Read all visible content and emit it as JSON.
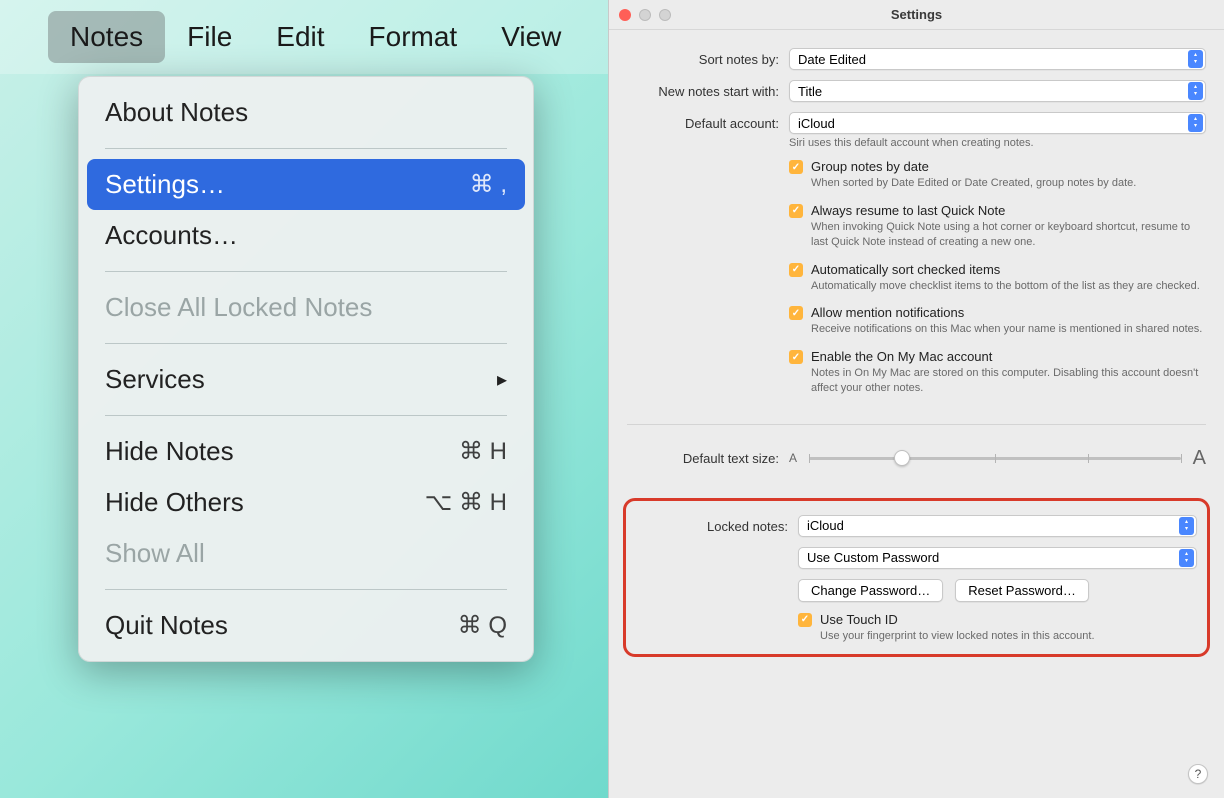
{
  "menubar": {
    "items": [
      {
        "label": "Notes",
        "active": true
      },
      {
        "label": "File"
      },
      {
        "label": "Edit"
      },
      {
        "label": "Format"
      },
      {
        "label": "View"
      }
    ]
  },
  "dropdown": {
    "about": "About Notes",
    "settings": "Settings…",
    "settings_shortcut": "⌘ ,",
    "accounts": "Accounts…",
    "close_locked": "Close All Locked Notes",
    "services": "Services",
    "hide_notes": "Hide Notes",
    "hide_notes_shortcut": "⌘ H",
    "hide_others": "Hide Others",
    "hide_others_shortcut": "⌥ ⌘ H",
    "show_all": "Show All",
    "quit": "Quit Notes",
    "quit_shortcut": "⌘ Q"
  },
  "settings": {
    "title": "Settings",
    "sort_label": "Sort notes by:",
    "sort_value": "Date Edited",
    "new_notes_label": "New notes start with:",
    "new_notes_value": "Title",
    "default_account_label": "Default account:",
    "default_account_value": "iCloud",
    "default_account_helper": "Siri uses this default account when creating notes.",
    "group": {
      "title": "Group notes by date",
      "desc": "When sorted by Date Edited or Date Created, group notes by date."
    },
    "resume": {
      "title": "Always resume to last Quick Note",
      "desc": "When invoking Quick Note using a hot corner or keyboard shortcut, resume to last Quick Note instead of creating a new one."
    },
    "autosort": {
      "title": "Automatically sort checked items",
      "desc": "Automatically move checklist items to the bottom of the list as they are checked."
    },
    "mention": {
      "title": "Allow mention notifications",
      "desc": "Receive notifications on this Mac when your name is mentioned in shared notes."
    },
    "onmymac": {
      "title": "Enable the On My Mac account",
      "desc": "Notes in On My Mac are stored on this computer. Disabling this account doesn't affect your other notes."
    },
    "text_size_label": "Default text size:",
    "text_size_small": "A",
    "text_size_large": "A",
    "locked_notes_label": "Locked notes:",
    "locked_notes_value": "iCloud",
    "password_mode": "Use Custom Password",
    "change_password": "Change Password…",
    "reset_password": "Reset Password…",
    "touch_id": {
      "title": "Use Touch ID",
      "desc": "Use your fingerprint to view locked notes in this account."
    },
    "help": "?"
  }
}
